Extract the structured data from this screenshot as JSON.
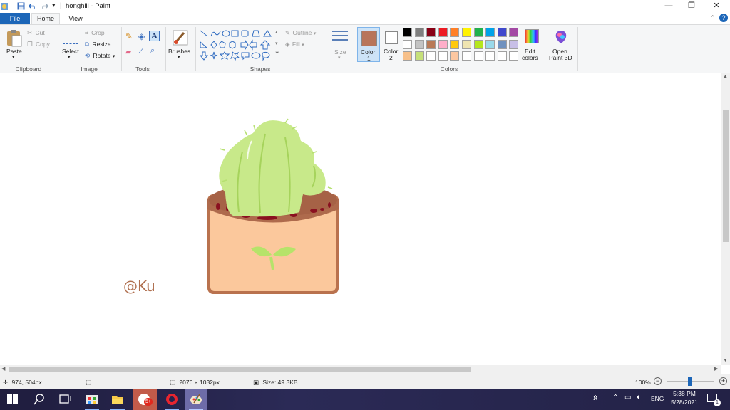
{
  "window": {
    "title": "honghiii - Paint",
    "minimize_icon": "minimize-icon",
    "maximize_icon": "restore-icon",
    "close_icon": "close-icon"
  },
  "quick_access": [
    "save-icon",
    "undo-icon",
    "redo-icon",
    "customize-icon"
  ],
  "tabs": [
    {
      "label": "File"
    },
    {
      "label": "Home"
    },
    {
      "label": "View"
    }
  ],
  "ribbon": {
    "clipboard": {
      "paste": "Paste",
      "cut": "Cut",
      "copy": "Copy",
      "group": "Clipboard"
    },
    "image": {
      "select": "Select",
      "crop": "Crop",
      "resize": "Resize",
      "rotate": "Rotate",
      "group": "Image"
    },
    "tools": {
      "group": "Tools"
    },
    "brushes": {
      "label": "Brushes"
    },
    "shapes": {
      "outline": "Outline",
      "fill": "Fill",
      "group": "Shapes"
    },
    "size": {
      "label": "Size"
    },
    "color1": {
      "label_line1": "Color",
      "label_line2": "1",
      "value": "#b8755a"
    },
    "color2": {
      "label_line1": "Color",
      "label_line2": "2",
      "value": "#ffffff"
    },
    "colors_group": "Colors",
    "edit_colors": {
      "line1": "Edit",
      "line2": "colors"
    },
    "open_3d": {
      "line1": "Open",
      "line2": "Paint 3D"
    },
    "palette_row1": [
      "#000000",
      "#7f7f7f",
      "#880015",
      "#ed1c24",
      "#ff7f27",
      "#fff200",
      "#22b14c",
      "#00a2e8",
      "#3f48cc",
      "#a349a4"
    ],
    "palette_row2": [
      "#ffffff",
      "#c3c3c3",
      "#b97a57",
      "#ffaec9",
      "#ffc90e",
      "#efe4b0",
      "#b5e61d",
      "#99d9ea",
      "#7092be",
      "#c8bfe7"
    ],
    "palette_row3": [
      "#f7c08a",
      "#c6e07a",
      "#ffffff",
      "#ffffff",
      "#fdc7a0",
      "#ffffff",
      "#ffffff",
      "#ffffff",
      "#ffffff",
      "#ffffff"
    ]
  },
  "canvas": {
    "signature": "@Ku"
  },
  "status": {
    "cursor_pos": "974, 504px",
    "image_dims": "2076 × 1032px",
    "file_size": "Size: 49.3KB",
    "zoom": "100%"
  },
  "taskbar": {
    "time": "5:38 PM",
    "date": "5/28/2021",
    "lang": "ENG",
    "notification_count": "1",
    "badge": "5+"
  }
}
